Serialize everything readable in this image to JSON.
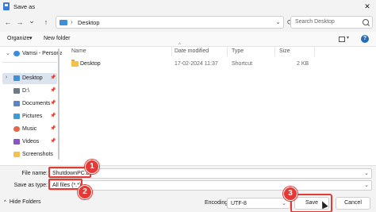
{
  "window": {
    "title": "Save as",
    "close_glyph": "✕"
  },
  "nav": {
    "back_glyph": "←",
    "forward_glyph": "→",
    "recent_glyph": "⌄",
    "up_glyph": "↑",
    "path_separator": "›",
    "path": "Desktop",
    "path_chevron": "⌄",
    "refresh_glyph": "⟳",
    "search_placeholder": "Search Desktop"
  },
  "commands": {
    "organize": "Organize",
    "organize_chevron": "▾",
    "new_folder": "New folder",
    "help_glyph": "?"
  },
  "sidebar": {
    "items": [
      {
        "label": "Vamsi - Persona",
        "icon": "cloud-icon",
        "color": "#3c8de0",
        "expander": "⌄"
      },
      {
        "label": "Desktop",
        "icon": "desktop-icon",
        "color": "#3f8fd9",
        "pinned": true,
        "selected": true,
        "expander": "›"
      },
      {
        "label": "D:\\",
        "icon": "drive-icon",
        "color": "#6b7a88",
        "pinned": true
      },
      {
        "label": "Documents",
        "icon": "documents-icon",
        "color": "#5a86c8",
        "pinned": true
      },
      {
        "label": "Pictures",
        "icon": "pictures-icon",
        "color": "#3b9ddb",
        "pinned": true
      },
      {
        "label": "Music",
        "icon": "music-icon",
        "color": "#e26a4a",
        "pinned": true
      },
      {
        "label": "Videos",
        "icon": "videos-icon",
        "color": "#8a54c8",
        "pinned": true
      },
      {
        "label": "Screenshots",
        "icon": "folder-icon",
        "color": "#f2c14e",
        "pinned": false
      }
    ],
    "pin_glyph": "📌"
  },
  "columns": {
    "name": "Name",
    "date": "Date modified",
    "type": "Type",
    "size": "Size",
    "sort_glyph": "^"
  },
  "files": [
    {
      "name": "Desktop",
      "date": "17-02-2024 11:37",
      "type": "Shortcut",
      "size": "2 KB"
    }
  ],
  "form": {
    "file_name_label": "File name:",
    "file_name_value": "ShutdownPC.bat",
    "save_type_label": "Save as type:",
    "save_type_value": "All files  (*.*)",
    "chevron": "⌄"
  },
  "footer": {
    "hide_folders": "Hide Folders",
    "hide_chevron": "^",
    "encoding_label": "Encoding:",
    "encoding_value": "UTF-8",
    "encoding_chevron": "⌄",
    "save": "Save",
    "cancel": "Cancel"
  },
  "callouts": [
    "1",
    "2",
    "3"
  ],
  "colors": {
    "accent": "#e53935",
    "selected": "#dbe3ee",
    "folder": "#f2c14e"
  }
}
